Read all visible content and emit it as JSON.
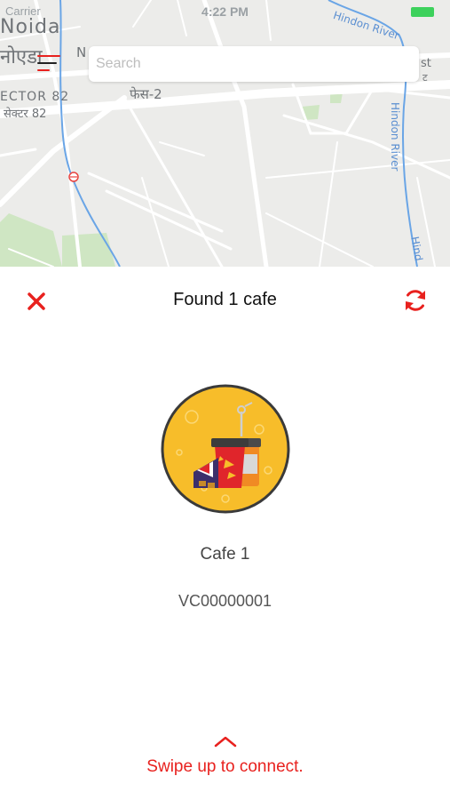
{
  "status_bar": {
    "carrier": "Carrier",
    "time": "4:22 PM"
  },
  "map": {
    "labels": {
      "noida": "Noida",
      "noida_hindi": "नोएडा",
      "sector_82": "ECTOR 82",
      "sector_82_hindi": "सेक्टर 82",
      "phase_2": "फेस-2",
      "n_label": "N",
      "hindon_river_top": "Hindon River",
      "hindon_river_side": "Hindon River",
      "hindon_river_side2": "Hind",
      "est_label": "st",
      "est_hindi": "ट"
    }
  },
  "search": {
    "placeholder": "Search",
    "value": ""
  },
  "sheet": {
    "title": "Found 1 cafe",
    "close_icon": "close-x-icon",
    "refresh_icon": "refresh-icon"
  },
  "cafe": {
    "name": "Cafe 1",
    "code": "VC00000001",
    "icon": "cafe-snacks-icon"
  },
  "footer": {
    "hint": "Swipe up to connect.",
    "chevron_icon": "chevron-up-icon"
  },
  "colors": {
    "accent": "#e8211e",
    "avatar_bg": "#f7bd2a",
    "avatar_border": "#3a3a3a",
    "map_bg": "#ececea",
    "river": "#6aa5e6",
    "battery": "#3dd15c"
  }
}
